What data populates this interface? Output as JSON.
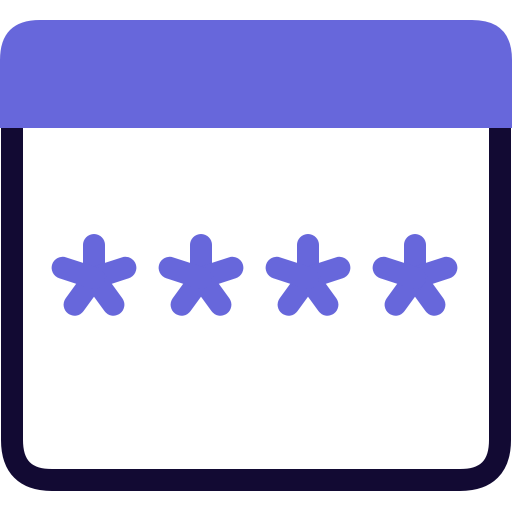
{
  "icon": {
    "name": "password-window-icon",
    "masked_character_count": 4,
    "colors": {
      "accent": "#6767DB",
      "outline": "#120A33",
      "background": "#FFFFFF"
    }
  }
}
